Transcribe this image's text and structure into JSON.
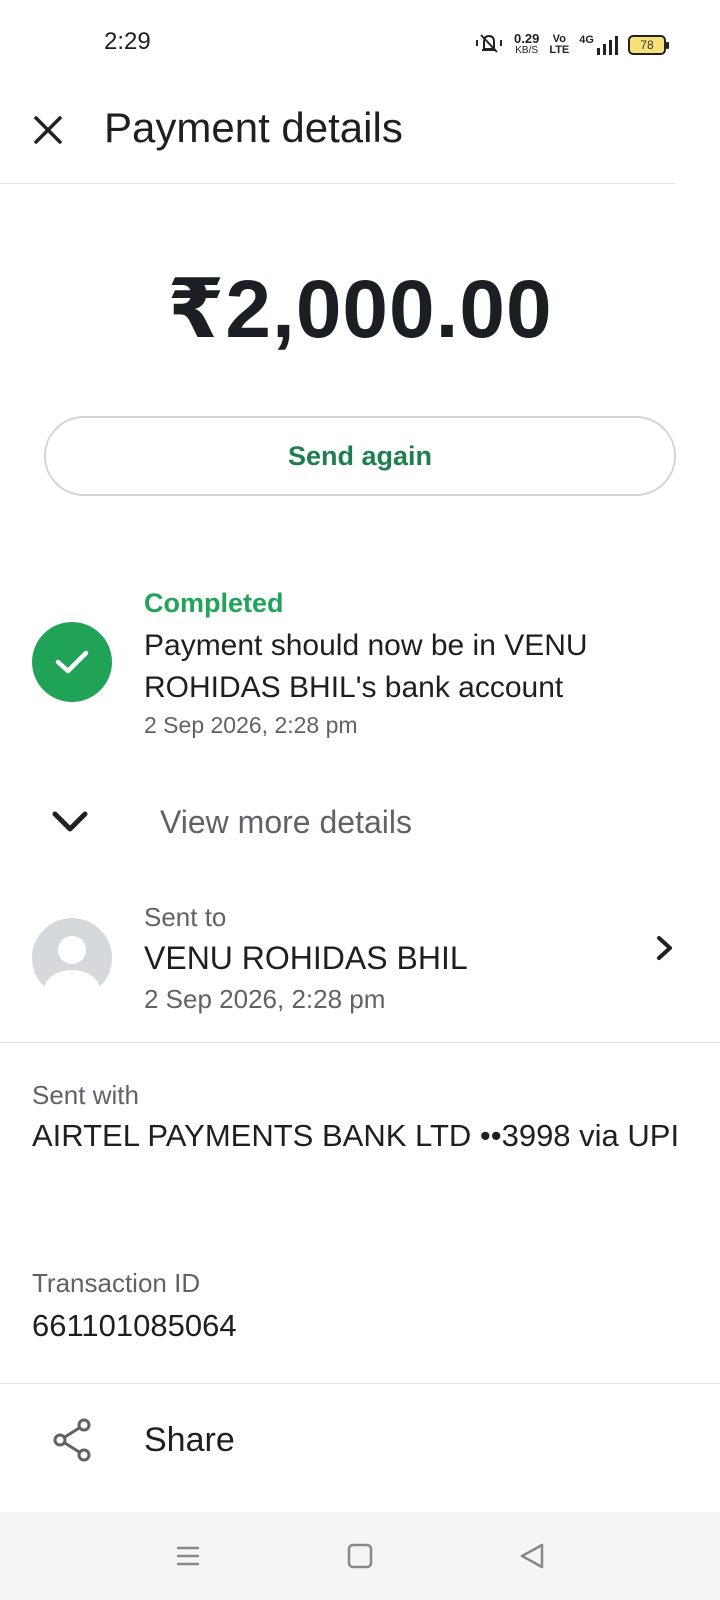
{
  "status_bar": {
    "time": "2:29",
    "net_speed_value": "0.29",
    "net_speed_unit": "KB/S",
    "volte_top": "Vo",
    "volte_bottom": "LTE",
    "network": "4G",
    "battery": "78",
    "icons": [
      "vibrate-mute-icon",
      "signal-icon"
    ]
  },
  "header": {
    "title": "Payment details",
    "close_icon": "close-icon"
  },
  "amount": "₹2,000.00",
  "send_again_label": "Send again",
  "status": {
    "title": "Completed",
    "message": "Payment should now be in VENU ROHIDAS BHIL's bank account",
    "timestamp": "2 Sep 2026, 2:28 pm",
    "color": "#21a357"
  },
  "more_details_label": "View more details",
  "recipient": {
    "label": "Sent to",
    "name": "VENU ROHIDAS BHIL",
    "timestamp": "2 Sep 2026, 2:28 pm"
  },
  "sent_with": {
    "label": "Sent with",
    "value": "AIRTEL PAYMENTS BANK LTD ••3998 via UPI"
  },
  "transaction": {
    "label": "Transaction ID",
    "value": "661101085064"
  },
  "share_label": "Share",
  "nav": {
    "menu_icon": "menu-icon",
    "home_icon": "home-square-icon",
    "back_icon": "back-triangle-icon"
  },
  "colors": {
    "accent_green": "#1e7e4e",
    "status_green": "#22a35a"
  }
}
